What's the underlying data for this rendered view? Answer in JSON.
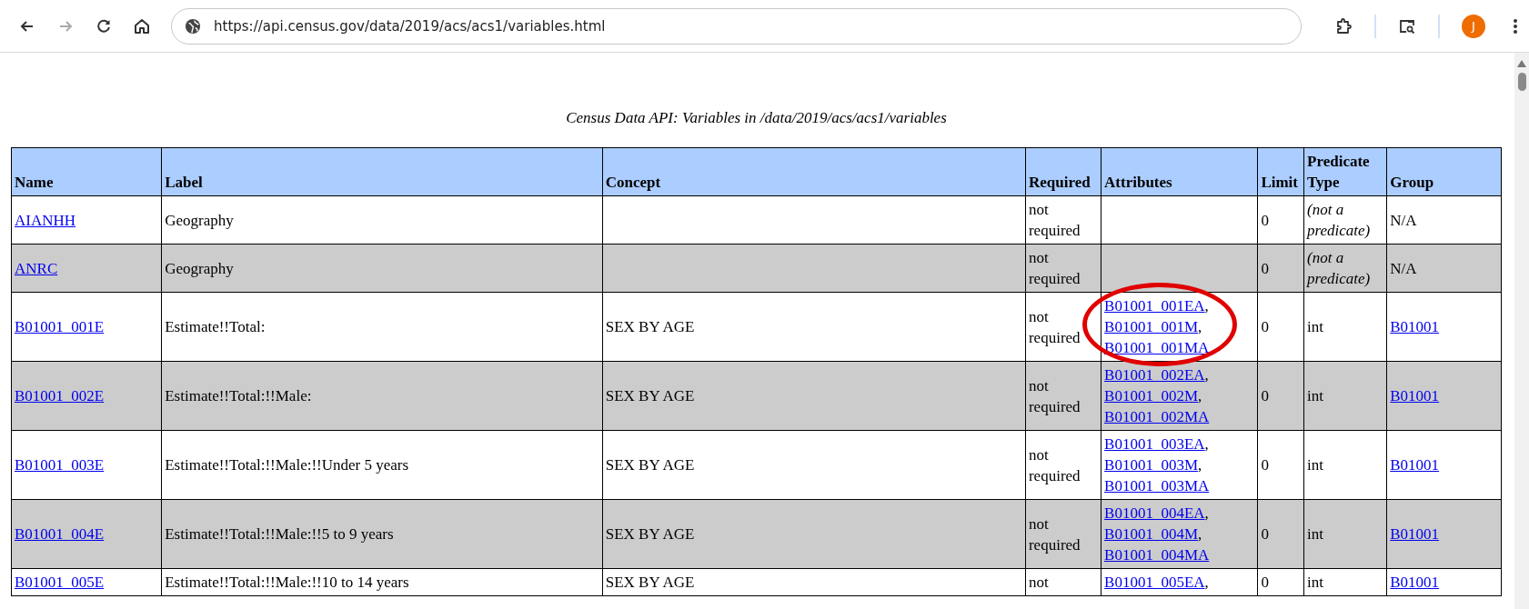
{
  "browser": {
    "url": "https://api.census.gov/data/2019/acs/acs1/variables.html",
    "back_disabled": false,
    "forward_disabled": true,
    "avatar_initial": "J"
  },
  "page": {
    "title": "Census Data API: Variables in /data/2019/acs/acs1/variables"
  },
  "table": {
    "columns": [
      "Name",
      "Label",
      "Concept",
      "Required",
      "Attributes",
      "Limit",
      "Predicate Type",
      "Group"
    ],
    "rows": [
      {
        "name": "AIANHH",
        "label": "Geography",
        "required": "not required",
        "attributes": [],
        "circled": false,
        "limit": "0",
        "predicate_type": {
          "text": "(not a predicate)",
          "kind": "none"
        },
        "group": {
          "text": "N/A",
          "link": false
        }
      },
      {
        "name": "ANRC",
        "label": "Geography",
        "required": "not required",
        "attributes": [],
        "circled": false,
        "limit": "0",
        "predicate_type": {
          "text": "(not a predicate)",
          "kind": "none"
        },
        "group": {
          "text": "N/A",
          "link": false
        }
      },
      {
        "name": "B01001_001E",
        "label": "Estimate!!Total:",
        "concept": "SEX BY AGE",
        "required": "not required",
        "attributes": [
          {
            "id": "B01001_001EA",
            "punct": ","
          },
          {
            "id": "B01001_001M",
            "punct": ","
          },
          {
            "id": "B01001_001MA"
          }
        ],
        "circled": true,
        "limit": "0",
        "predicate_type": {
          "text": "int",
          "kind": "type"
        },
        "group": {
          "text": "B01001",
          "link": true
        }
      },
      {
        "name": "B01001_002E",
        "label": "Estimate!!Total:!!Male:",
        "concept": "SEX BY AGE",
        "required": "not required",
        "attributes": [
          {
            "id": "B01001_002EA",
            "punct": ","
          },
          {
            "id": "B01001_002M",
            "punct": ","
          },
          {
            "id": "B01001_002MA"
          }
        ],
        "circled": false,
        "limit": "0",
        "predicate_type": {
          "text": "int",
          "kind": "type"
        },
        "group": {
          "text": "B01001",
          "link": true
        }
      },
      {
        "name": "B01001_003E",
        "label": "Estimate!!Total:!!Male:!!Under 5 years",
        "concept": "SEX BY AGE",
        "required": "not required",
        "attributes": [
          {
            "id": "B01001_003EA",
            "punct": ","
          },
          {
            "id": "B01001_003M",
            "punct": ","
          },
          {
            "id": "B01001_003MA"
          }
        ],
        "circled": false,
        "limit": "0",
        "predicate_type": {
          "text": "int",
          "kind": "type"
        },
        "group": {
          "text": "B01001",
          "link": true
        }
      },
      {
        "name": "B01001_004E",
        "label": "Estimate!!Total:!!Male:!!5 to 9 years",
        "concept": "SEX BY AGE",
        "required": "not required",
        "attributes": [
          {
            "id": "B01001_004EA",
            "punct": ","
          },
          {
            "id": "B01001_004M",
            "punct": ","
          },
          {
            "id": "B01001_004MA"
          }
        ],
        "circled": false,
        "limit": "0",
        "predicate_type": {
          "text": "int",
          "kind": "type"
        },
        "group": {
          "text": "B01001",
          "link": true
        }
      },
      {
        "name": "B01001_005E",
        "label": "Estimate!!Total:!!Male:!!10 to 14 years",
        "concept": "SEX BY AGE",
        "required": "not",
        "attributes": [
          {
            "id": "B01001_005EA",
            "punct": ","
          }
        ],
        "circled": false,
        "limit": "0",
        "predicate_type": {
          "text": "int",
          "kind": "type"
        },
        "group": {
          "text": "B01001",
          "link": true
        }
      }
    ]
  }
}
